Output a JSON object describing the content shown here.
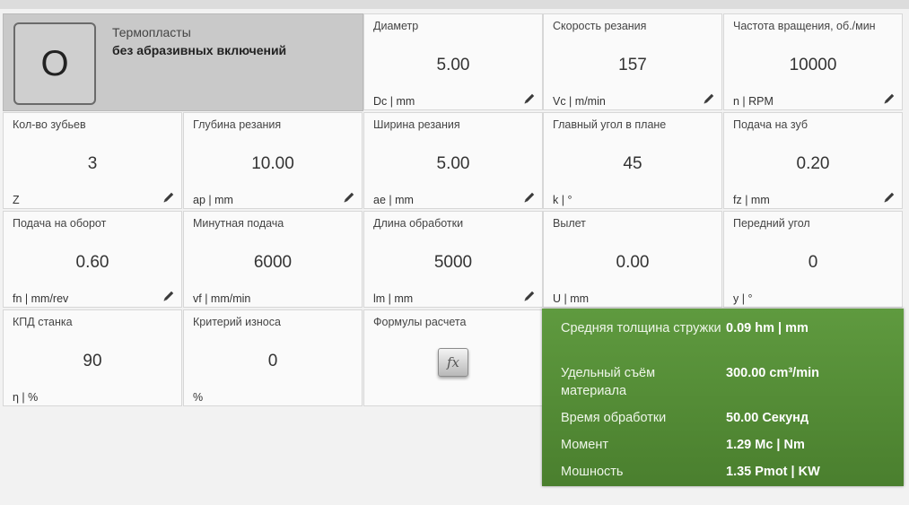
{
  "material": {
    "letter": "O",
    "name": "Термопласты",
    "description": "без абразивных включений"
  },
  "params": {
    "diameter": {
      "label": "Диаметр",
      "value": "5.00",
      "unit": "Dc | mm"
    },
    "cutting_speed": {
      "label": "Скорость резания",
      "value": "157",
      "unit": "Vc | m/min"
    },
    "rotation": {
      "label": "Частота вращения, об./мин",
      "value": "10000",
      "unit": "n | RPM"
    },
    "teeth": {
      "label": "Кол-во зубьев",
      "value": "3",
      "unit": "Z"
    },
    "depth": {
      "label": "Глубина резания",
      "value": "10.00",
      "unit": "ap | mm"
    },
    "width": {
      "label": "Ширина резания",
      "value": "5.00",
      "unit": "ae | mm"
    },
    "lead_angle": {
      "label": "Главный угол в плане",
      "value": "45",
      "unit": "k | °"
    },
    "feed_tooth": {
      "label": "Подача на зуб",
      "value": "0.20",
      "unit": "fz | mm"
    },
    "feed_rev": {
      "label": "Подача на оборот",
      "value": "0.60",
      "unit": "fn | mm/rev"
    },
    "feed_min": {
      "label": "Минутная подача",
      "value": "6000",
      "unit": "vf | mm/min"
    },
    "length": {
      "label": "Длина обработки",
      "value": "5000",
      "unit": "lm | mm"
    },
    "overhang": {
      "label": "Вылет",
      "value": "0.00",
      "unit": "U | mm"
    },
    "rake_angle": {
      "label": "Передний угол",
      "value": "0",
      "unit": "y | °"
    },
    "efficiency": {
      "label": "КПД станка",
      "value": "90",
      "unit": "η | %"
    },
    "wear": {
      "label": "Критерий износа",
      "value": "0",
      "unit": "%"
    },
    "formulas": {
      "label": "Формулы расчета",
      "button": "fx"
    }
  },
  "results": [
    {
      "label": "Средняя толщина стружки",
      "value": "0.09 hm | mm"
    },
    {
      "label": "Удельный съём материала",
      "value": "300.00 cm³/min"
    },
    {
      "label": "Время обработки",
      "value": "50.00 Секунд"
    },
    {
      "label": "Момент",
      "value": "1.29 Mc | Nm"
    },
    {
      "label": "Мошность",
      "value": "1.35 Pmot | KW"
    }
  ],
  "colors": {
    "results_bg": "#5a9238",
    "material_bg": "#c9c9c9"
  },
  "icons": {
    "edit": "pencil-icon"
  }
}
